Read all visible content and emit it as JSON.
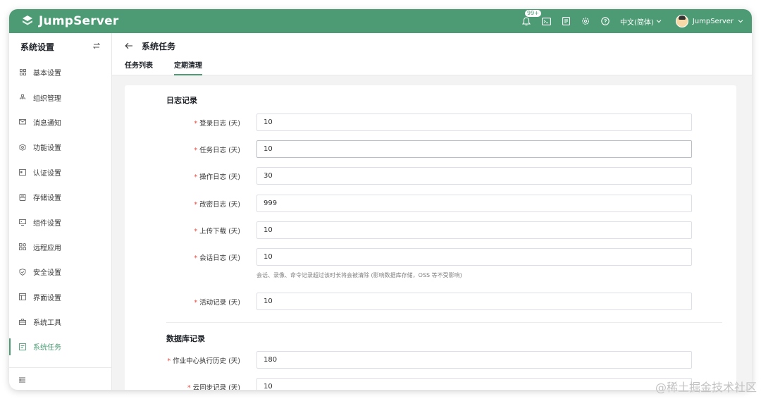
{
  "app": {
    "logo_text": "JumpServer"
  },
  "topbar": {
    "notification_badge": "99+",
    "language": "中文(简体)",
    "user_name": "JumpServer"
  },
  "sidebar": {
    "title": "系统设置",
    "items": [
      {
        "label": "基本设置",
        "icon": "grid-icon"
      },
      {
        "label": "组织管理",
        "icon": "org-icon"
      },
      {
        "label": "消息通知",
        "icon": "message-icon"
      },
      {
        "label": "功能设置",
        "icon": "feature-icon"
      },
      {
        "label": "认证设置",
        "icon": "auth-icon"
      },
      {
        "label": "存储设置",
        "icon": "storage-icon"
      },
      {
        "label": "组件设置",
        "icon": "component-icon"
      },
      {
        "label": "远程应用",
        "icon": "apps-icon"
      },
      {
        "label": "安全设置",
        "icon": "shield-icon"
      },
      {
        "label": "界面设置",
        "icon": "interface-icon"
      },
      {
        "label": "系统工具",
        "icon": "toolbox-icon"
      },
      {
        "label": "系统任务",
        "icon": "task-icon",
        "active": true
      }
    ]
  },
  "header": {
    "title": "系统任务",
    "tabs": [
      {
        "label": "任务列表"
      },
      {
        "label": "定期清理",
        "active": true
      }
    ]
  },
  "form": {
    "log_section": "日志记录",
    "fields": [
      {
        "label": "登录日志 (天)",
        "value": "10"
      },
      {
        "label": "任务日志 (天)",
        "value": "10"
      },
      {
        "label": "操作日志 (天)",
        "value": "30"
      },
      {
        "label": "改密日志 (天)",
        "value": "999"
      },
      {
        "label": "上传下载 (天)",
        "value": "10"
      },
      {
        "label": "会话日志 (天)",
        "value": "10"
      },
      {
        "label": "活动记录 (天)",
        "value": "10"
      }
    ],
    "session_hint": "会话、录像、命令记录超过该时长将会被清除 (影响数据库存储，OSS 等不受影响)",
    "db_section": "数据库记录",
    "db_fields": [
      {
        "label": "作业中心执行历史 (天)",
        "value": "180"
      },
      {
        "label": "云同步记录 (天)",
        "value": "10"
      }
    ]
  },
  "watermark": "@稀土掘金技术社区",
  "colors": {
    "brand": "#4c9b74",
    "required": "#e54d42"
  }
}
